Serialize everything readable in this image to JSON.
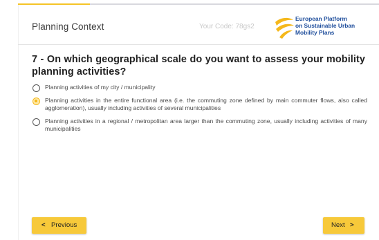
{
  "progress": {
    "fraction": 0.2,
    "fill_color": "#f5c426",
    "track_color": "#d8d8de"
  },
  "header": {
    "title": "Planning Context",
    "code": "Your Code: 78gs2",
    "logo": {
      "lines": [
        "European Platform",
        "on Sustainable Urban",
        "Mobility Plans"
      ],
      "text_color": "#1f4e9c",
      "mark_color": "#f5b81b"
    }
  },
  "question": {
    "text": "7 - On which geographical scale do you want to assess your mobility planning activities?"
  },
  "options": [
    {
      "label": "Planning activities of my city / municipality",
      "selected": false
    },
    {
      "label": "Planning activities in the entire functional area (i.e. the commuting zone defined by main commuter flows, also called agglomeration), usually including activities of several municipalities",
      "selected": true
    },
    {
      "label": "Planning activities in a regional / metropolitan area larger than the commuting zone, usually including activities of many municipalities",
      "selected": false
    }
  ],
  "nav": {
    "previous_label": "Previous",
    "previous_icon": "chevron-left-icon",
    "next_label": "Next",
    "next_icon": "chevron-right-icon",
    "button_color": "#f7c93a"
  }
}
